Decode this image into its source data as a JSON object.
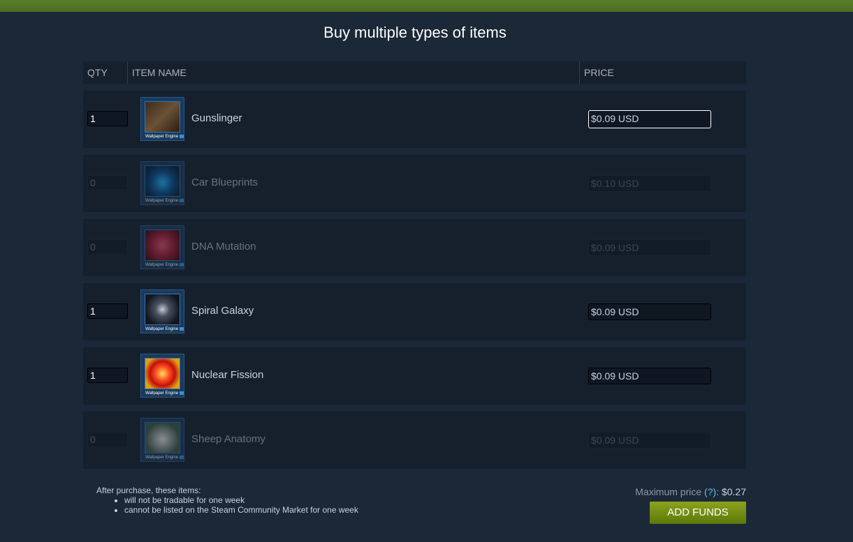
{
  "title": "Buy multiple types of items",
  "columns": {
    "qty": "QTY",
    "item_name": "ITEM NAME",
    "price": "PRICE"
  },
  "items": [
    {
      "qty": "1",
      "name": "Gunslinger",
      "price": "$0.09 USD",
      "thumb_caption": "Wallpaper Engine"
    },
    {
      "qty": "0",
      "name": "Car Blueprints",
      "price": "$0.10 USD",
      "thumb_caption": "Wallpaper Engine"
    },
    {
      "qty": "0",
      "name": "DNA Mutation",
      "price": "$0.09 USD",
      "thumb_caption": "Wallpaper Engine"
    },
    {
      "qty": "1",
      "name": "Spiral Galaxy",
      "price": "$0.09 USD",
      "thumb_caption": "Wallpaper Engine"
    },
    {
      "qty": "1",
      "name": "Nuclear Fission",
      "price": "$0.09 USD",
      "thumb_caption": "Wallpaper Engine"
    },
    {
      "qty": "0",
      "name": "Sheep Anatomy",
      "price": "$0.09 USD",
      "thumb_caption": "Wallpaper Engine"
    }
  ],
  "notes": {
    "intro": "After purchase, these items:",
    "bullets": [
      "will not be tradable for one week",
      "cannot be listed on the Steam Community Market for one week"
    ]
  },
  "summary": {
    "max_price_label": "Maximum price",
    "help": "(?)",
    "max_price_value": "$0.27"
  },
  "add_funds_label": "ADD FUNDS"
}
